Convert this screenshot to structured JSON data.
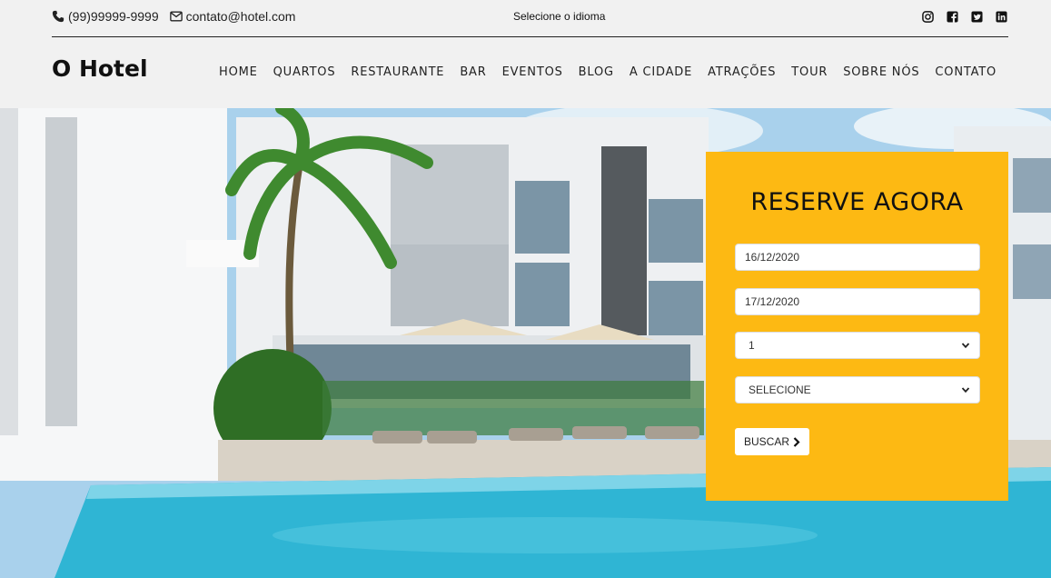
{
  "topbar": {
    "phone": "(99)99999-9999",
    "email": "contato@hotel.com",
    "language": "Selecione o idioma",
    "social": [
      "instagram-icon",
      "facebook-icon",
      "twitter-icon",
      "linkedin-icon"
    ]
  },
  "brand": "O Hotel",
  "nav": [
    "HOME",
    "QUARTOS",
    "RESTAURANTE",
    "BAR",
    "EVENTOS",
    "BLOG",
    "A CIDADE",
    "ATRAÇÕES",
    "TOUR",
    "SOBRE NÓS",
    "CONTATO"
  ],
  "booking": {
    "title": "RESERVE AGORA",
    "checkin": "16/12/2020",
    "checkout": "17/12/2020",
    "guests": "1",
    "room": "SELECIONE",
    "button": "BUSCAR"
  },
  "colors": {
    "accent": "#fdb913",
    "background": "#f1f1f1",
    "pool": "#2fb5d4"
  }
}
